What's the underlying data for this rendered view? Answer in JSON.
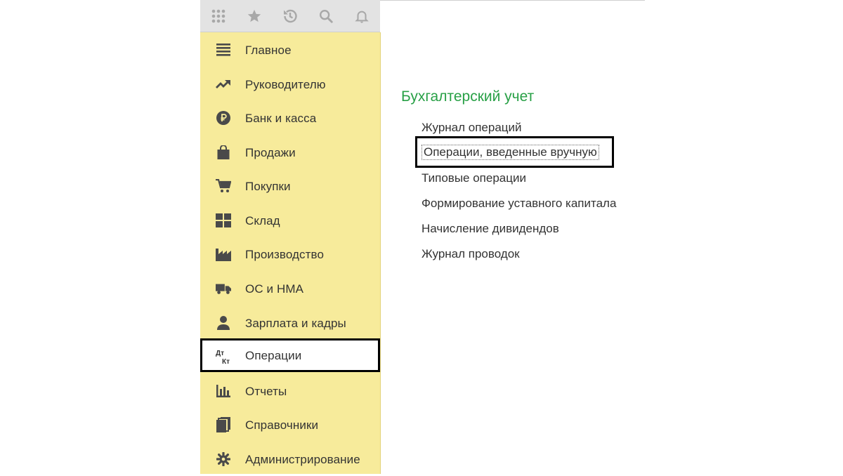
{
  "toolbar": {
    "buttons": [
      {
        "icon": "apps-grid-icon"
      },
      {
        "icon": "star-icon"
      },
      {
        "icon": "history-icon"
      },
      {
        "icon": "search-icon"
      },
      {
        "icon": "bell-icon"
      }
    ]
  },
  "sidebar": {
    "items": [
      {
        "label": "Главное",
        "icon": "menu-icon"
      },
      {
        "label": "Руководителю",
        "icon": "trend-icon"
      },
      {
        "label": "Банк и касса",
        "icon": "ruble-icon"
      },
      {
        "label": "Продажи",
        "icon": "bag-icon"
      },
      {
        "label": "Покупки",
        "icon": "cart-icon"
      },
      {
        "label": "Склад",
        "icon": "warehouse-icon"
      },
      {
        "label": "Производство",
        "icon": "factory-icon"
      },
      {
        "label": "ОС и НМА",
        "icon": "truck-icon"
      },
      {
        "label": "Зарплата и кадры",
        "icon": "person-icon"
      },
      {
        "label": "Операции",
        "icon": "dt-kt-icon",
        "active": true
      },
      {
        "label": "Отчеты",
        "icon": "bar-chart-icon"
      },
      {
        "label": "Справочники",
        "icon": "books-icon"
      },
      {
        "label": "Администрирование",
        "icon": "gear-icon"
      }
    ],
    "dtkt": {
      "top": "Дт",
      "bottom": "Кт"
    }
  },
  "content": {
    "section_title": "Бухгалтерский учет",
    "links": [
      "Журнал операций",
      "Операции, введенные вручную",
      "Типовые операции",
      "Формирование уставного капитала",
      "Начисление дивидендов",
      "Журнал проводок"
    ]
  },
  "colors": {
    "sidebar_bg": "#f7eb9b",
    "section_title": "#28a046",
    "text": "#333333",
    "icon": "#4a4a4a",
    "toolbar_bg": "#e3e3e3"
  }
}
